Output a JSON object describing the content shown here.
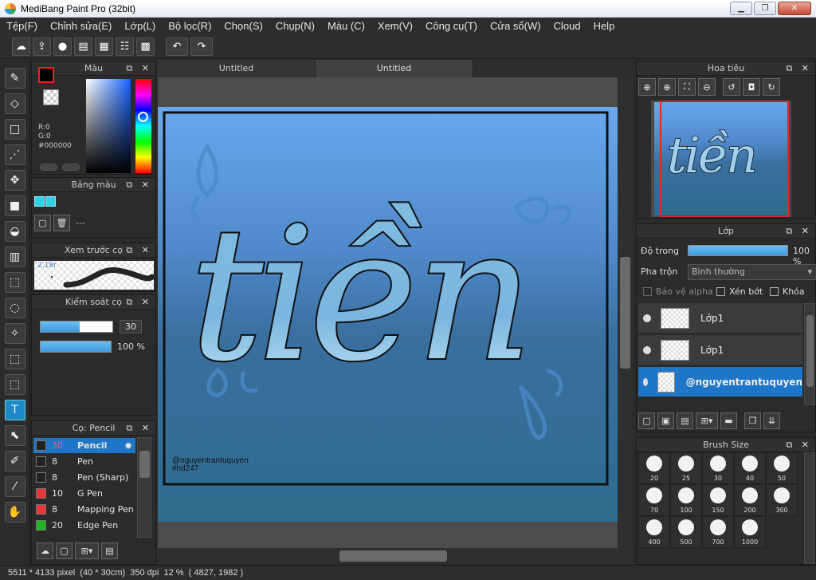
{
  "window": {
    "title": "MediBang Paint Pro (32bit)",
    "minimize": "▁",
    "maximize": "❐",
    "close": "✕"
  },
  "menu": [
    "Tệp(F)",
    "Chỉnh sửa(E)",
    "Lớp(L)",
    "Bộ lọc(R)",
    "Chọn(S)",
    "Chụp(N)",
    "Màu (C)",
    "Xem(V)",
    "Công cụ(T)",
    "Cửa sổ(W)",
    "Cloud",
    "Help"
  ],
  "toolbar": [
    {
      "icon": "cloud-icon",
      "glyph": "☁"
    },
    {
      "icon": "share-icon",
      "glyph": "⇪"
    },
    {
      "icon": "comment-icon",
      "glyph": "●"
    },
    {
      "icon": "note-icon",
      "glyph": "▤"
    },
    {
      "icon": "page-icon",
      "glyph": "▦"
    },
    {
      "icon": "list-icon",
      "glyph": "☷"
    },
    {
      "icon": "grid-icon",
      "glyph": "▩"
    },
    {
      "icon": "undo-icon",
      "glyph": "↶"
    },
    {
      "icon": "redo-icon",
      "glyph": "↷"
    }
  ],
  "tools": [
    {
      "name": "brush-tool-icon",
      "glyph": "✎"
    },
    {
      "name": "eraser-tool-icon",
      "glyph": "◇"
    },
    {
      "name": "rectangle-tool-icon",
      "glyph": "□"
    },
    {
      "name": "dot-tool-icon",
      "glyph": "⋰"
    },
    {
      "name": "move-tool-icon",
      "glyph": "✥"
    },
    {
      "name": "fill-rect-tool-icon",
      "glyph": "■"
    },
    {
      "name": "bucket-tool-icon",
      "glyph": "◒"
    },
    {
      "name": "gradient-tool-icon",
      "glyph": "▥"
    },
    {
      "name": "select-tool-icon",
      "glyph": "⬚"
    },
    {
      "name": "lasso-tool-icon",
      "glyph": "◌"
    },
    {
      "name": "magic-wand-tool-icon",
      "glyph": "✧"
    },
    {
      "name": "select-pen-tool-icon",
      "glyph": "⬚"
    },
    {
      "name": "select-eraser-tool-icon",
      "glyph": "⬚"
    },
    {
      "name": "text-tool-icon",
      "glyph": "T"
    },
    {
      "name": "operation-tool-icon",
      "glyph": "⬉"
    },
    {
      "name": "divide-tool-icon",
      "glyph": "✐"
    },
    {
      "name": "eyedropper-tool-icon",
      "glyph": "⁄"
    },
    {
      "name": "hand-tool-icon",
      "glyph": "✋"
    }
  ],
  "color_panel": {
    "title": "Màu",
    "r": "R:0",
    "g": "G:0",
    "hex": "#000000",
    "fg": "#000000",
    "accent": "#1462ff"
  },
  "palette_panel": {
    "title": "Bảng màu",
    "colors": [
      "#2fd3e6",
      "#2fd3e6"
    ],
    "dash": "---"
  },
  "preview_panel": {
    "title": "Xem trước cọ",
    "size_text": "2.18r"
  },
  "brush_control": {
    "title": "Kiểm soát cọ",
    "size_value": "30",
    "opacity_value": "100 %",
    "size_fraction": 0.54,
    "opacity_fraction": 1.0
  },
  "brush_panel": {
    "title": "Cọ: Pencil",
    "items": [
      {
        "color": "#222222",
        "size": "30",
        "name": "Pencil",
        "selected": true
      },
      {
        "color": "#222222",
        "size": "8",
        "name": "Pen"
      },
      {
        "color": "#222222",
        "size": "8",
        "name": "Pen (Sharp)"
      },
      {
        "color": "#e53935",
        "size": "10",
        "name": "G Pen"
      },
      {
        "color": "#e53935",
        "size": "8",
        "name": "Mapping Pen"
      },
      {
        "color": "#21b521",
        "size": "20",
        "name": "Edge Pen"
      }
    ]
  },
  "doc_tabs": [
    "Untitled",
    "Untitled"
  ],
  "canvas": {
    "word": "tiền",
    "watermark_line1": "@nguyentrantuquyen",
    "watermark_line2": "#hd247",
    "bg_top": "#6ba7ec",
    "bg_bottom": "#2d6c8e"
  },
  "navigator_panel": {
    "title": "Hoa tiêu"
  },
  "layer_panel": {
    "title": "Lớp",
    "opacity_label": "Độ trong",
    "opacity_value": "100 %",
    "blend_label": "Pha trộn",
    "blend_value": "Bình thường",
    "protect_alpha": "Bảo vệ alpha",
    "clipping": "Xén bớt",
    "lock": "Khóa",
    "layers": [
      {
        "name": "Lớp1",
        "selected": false
      },
      {
        "name": "Lớp1",
        "selected": false
      },
      {
        "name": "@nguyentrantuquyen",
        "selected": true
      }
    ]
  },
  "brush_size_panel": {
    "title": "Brush Size",
    "sizes": [
      "20",
      "25",
      "30",
      "40",
      "50",
      "70",
      "100",
      "150",
      "200",
      "300",
      "400",
      "500",
      "700",
      "1000"
    ]
  },
  "status": {
    "text": "5511 * 4133 pixel  (40 * 30cm)  350 dpi  12 %  ( 4827, 1982 )"
  }
}
